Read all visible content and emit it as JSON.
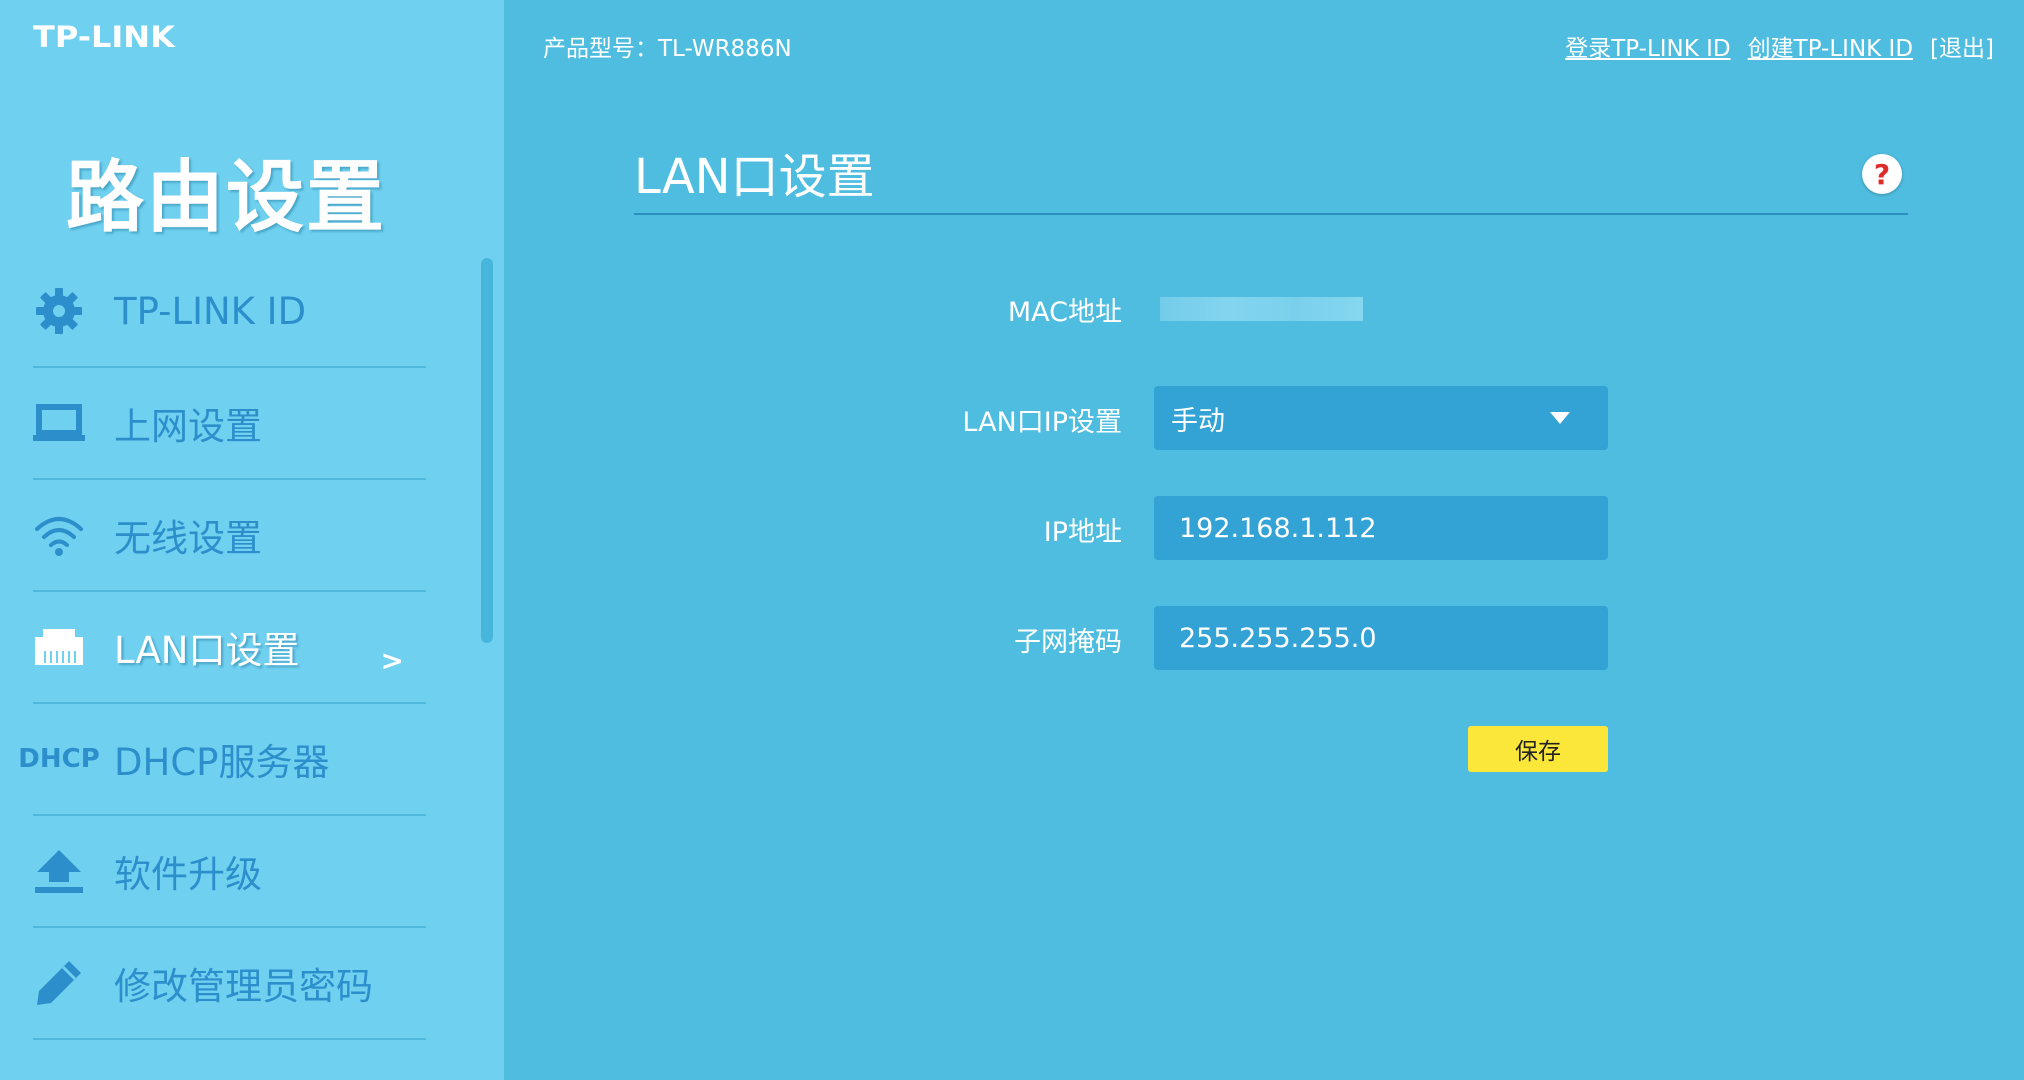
{
  "brand": {
    "logo_text": "TP-LINK"
  },
  "header": {
    "product_label": "产品型号：TL-WR886N",
    "links": {
      "login": "登录TP-LINK ID",
      "create": "创建TP-LINK ID",
      "logout": "[退出]"
    }
  },
  "sidebar": {
    "title": "路由设置",
    "items": [
      {
        "label": "TP-LINK ID",
        "icon": "gear-icon"
      },
      {
        "label": "上网设置",
        "icon": "laptop-icon"
      },
      {
        "label": "无线设置",
        "icon": "wifi-icon"
      },
      {
        "label": "LAN口设置",
        "icon": "ethernet-port-icon",
        "active": true,
        "arrow": ">"
      },
      {
        "label": "DHCP服务器",
        "icon": "dhcp-icon",
        "icon_text_top": "DH",
        "icon_text_bottom": "CP"
      },
      {
        "label": "软件升级",
        "icon": "upload-icon"
      },
      {
        "label": "修改管理员密码",
        "icon": "pencil-icon"
      }
    ]
  },
  "main": {
    "title": "LAN口设置",
    "help_symbol": "?",
    "form": {
      "mac_label": "MAC地址",
      "lan_ip_mode_label": "LAN口IP设置",
      "lan_ip_mode_value": "手动",
      "ip_label": "IP地址",
      "ip_value": "192.168.1.112",
      "mask_label": "子网掩码",
      "mask_value": "255.255.255.0",
      "save_label": "保存"
    }
  },
  "colors": {
    "background": "#4fbde0",
    "sidebar": "#6fd0ef",
    "menu_text": "#2c8fcc",
    "field": "#33a3d6",
    "save_button": "#fbe73a",
    "help_mark": "#e02b2b"
  }
}
